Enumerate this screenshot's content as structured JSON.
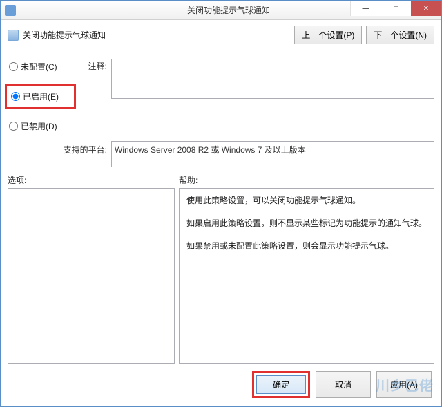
{
  "window": {
    "title": "关闭功能提示气球通知"
  },
  "policy": {
    "title": "关闭功能提示气球通知",
    "prev_button": "上一个设置(P)",
    "next_button": "下一个设置(N)"
  },
  "radios": {
    "not_configured": "未配置(C)",
    "enabled": "已启用(E)",
    "disabled": "已禁用(D)",
    "selected": "enabled"
  },
  "labels": {
    "comment": "注释:",
    "platform": "支持的平台:",
    "options": "选项:",
    "help": "帮助:"
  },
  "comment_value": "",
  "platform_text": "Windows Server 2008 R2 或 Windows 7 及以上版本",
  "help": {
    "p1": "使用此策略设置，可以关闭功能提示气球通知。",
    "p2": "如果启用此策略设置，则不显示某些标记为功能提示的通知气球。",
    "p3": "如果禁用或未配置此策略设置，则会显示功能提示气球。"
  },
  "buttons": {
    "ok": "确定",
    "cancel": "取消",
    "apply": "应用(A)"
  },
  "watermark": "川乡巴佬"
}
